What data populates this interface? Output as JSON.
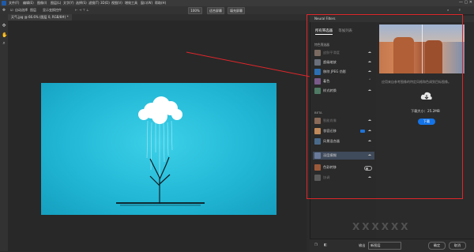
{
  "menubar": {
    "items": [
      "文件(F)",
      "编辑(E)",
      "图像(I)",
      "图层(L)",
      "文字(Y)",
      "选择(S)",
      "滤镜(T)",
      "3D(D)",
      "视图(V)",
      "增效工具",
      "窗口(W)",
      "帮助(H)"
    ]
  },
  "options": {
    "auto_select": "自动选择",
    "layer_select": "图层",
    "show_transform": "显示变换控件",
    "zoom": "100%",
    "fit_screen": "适合屏幕",
    "fill_screen": "填充屏幕"
  },
  "document": {
    "tab_label": "天气.jpg @ 66.6% (图层 0, RGB/8#) *"
  },
  "neural_filters": {
    "title": "Neural Filters",
    "tab_all": "所有筛选器",
    "tab_wait": "等候列表",
    "section_featured": "特色筛选器",
    "section_beta": "BETA",
    "featured": [
      {
        "label": "皮肤平滑度",
        "dim": true,
        "icon": "cloud-download-icon",
        "thumb": "#7a6a60"
      },
      {
        "label": "超级缩放",
        "dim": false,
        "icon": "cloud-download-icon",
        "thumb": "#6a6f7a"
      },
      {
        "label": "移除 JPEG 伪影",
        "dim": false,
        "icon": "cloud-download-icon",
        "thumb": "#2d6fb3"
      },
      {
        "label": "着色",
        "dim": false,
        "icon": "chevron-icon",
        "thumb": "#7a5a8a"
      },
      {
        "label": "样式转换",
        "dim": false,
        "icon": "cloud-download-icon",
        "thumb": "#4f7a63"
      }
    ],
    "beta": [
      {
        "label": "智能肖像",
        "dim": true,
        "icon": "cloud-download-icon",
        "thumb": "#8a6a58"
      },
      {
        "label": "妆容迁移",
        "dim": false,
        "icon": "badge",
        "thumb": "#c08a5a"
      },
      {
        "label": "风景混合器",
        "dim": false,
        "icon": "cloud-download-icon",
        "thumb": "#4a6a8a"
      },
      {
        "label": "深度模糊",
        "dim": false,
        "icon": "cloud-download-icon",
        "thumb": "#6a7a9a",
        "selected": true
      },
      {
        "label": "色彩转移",
        "dim": false,
        "icon": "toggle",
        "thumb": "#9a5a3a"
      },
      {
        "label": "协调",
        "dim": true,
        "icon": "cloud-download-icon",
        "thumb": "#5a5a5a"
      }
    ],
    "caption": "应用来自参考图像的特定风格和色调到目标图像。",
    "download_size": "下载大小：25.2MB",
    "download_button": "下载"
  },
  "bottom": {
    "output_label": "输出",
    "output_value": "新图层",
    "ok": "确定",
    "cancel": "取消"
  },
  "watermark": "ⅩⅩⅩⅩⅩⅩ",
  "colors": {
    "accent": "#1473e6",
    "annotation_red": "#e0262a",
    "canvas_cyan": "#22b8d6"
  }
}
